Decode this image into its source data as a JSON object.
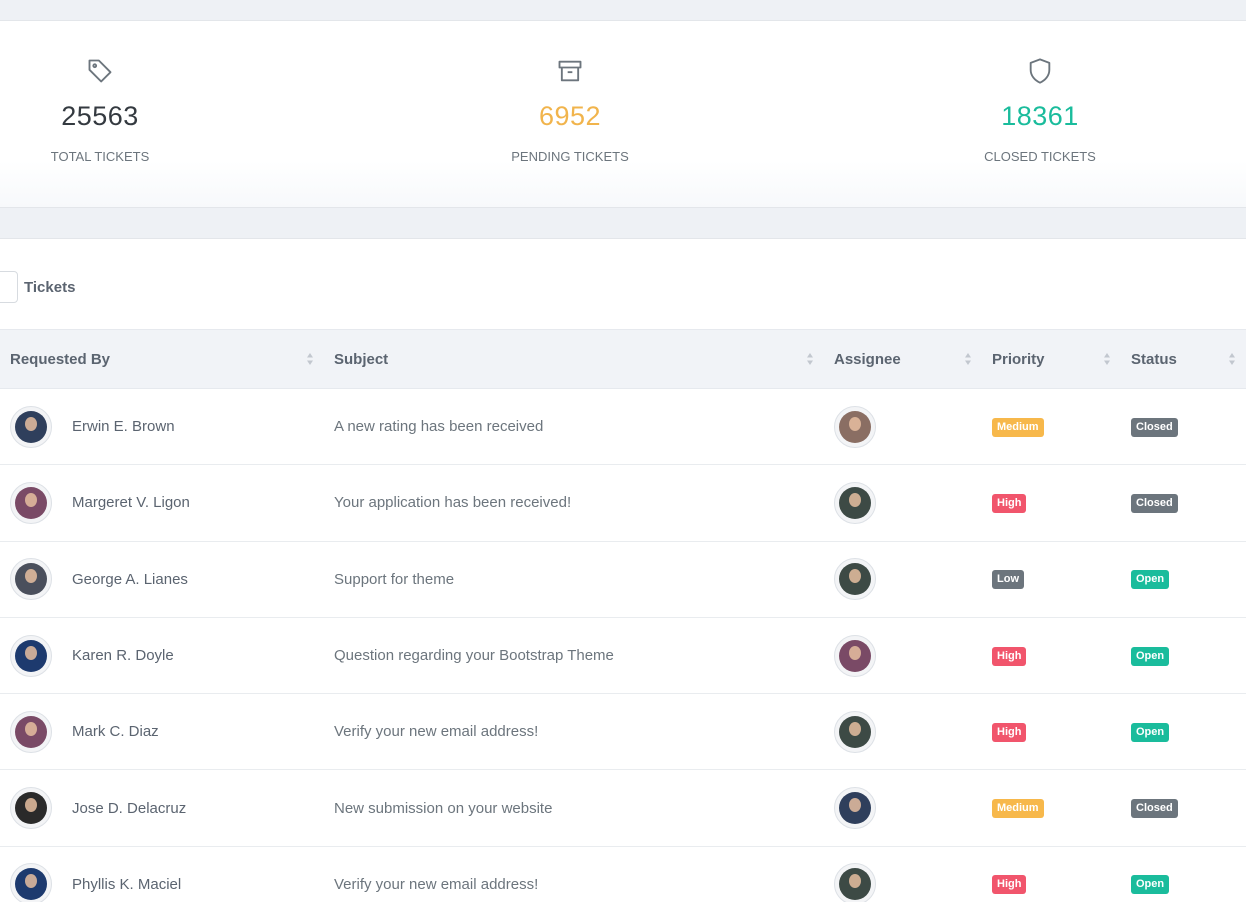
{
  "stats": [
    {
      "id": "total",
      "icon": "tag-icon",
      "value": "25563",
      "label": "Total Tickets",
      "color": "#343a40"
    },
    {
      "id": "pending",
      "icon": "archive-icon",
      "value": "6952",
      "label": "Pending Tickets",
      "color": "#f1b44c"
    },
    {
      "id": "closed",
      "icon": "shield-icon",
      "value": "18361",
      "label": "Closed Tickets",
      "color": "#1abc9c"
    }
  ],
  "tickets_card": {
    "title": "Tickets",
    "columns": [
      "Requested By",
      "Subject",
      "Assignee",
      "Priority",
      "Status"
    ],
    "rows": [
      {
        "requester": "Erwin E. Brown",
        "subject": "A new rating has been received",
        "priority": "Medium",
        "status": "Closed"
      },
      {
        "requester": "Margeret V. Ligon",
        "subject": "Your application has been received!",
        "priority": "High",
        "status": "Closed"
      },
      {
        "requester": "George A. Lianes",
        "subject": "Support for theme",
        "priority": "Low",
        "status": "Open"
      },
      {
        "requester": "Karen R. Doyle",
        "subject": "Question regarding your Bootstrap Theme",
        "priority": "High",
        "status": "Open"
      },
      {
        "requester": "Mark C. Diaz",
        "subject": "Verify your new email address!",
        "priority": "High",
        "status": "Open"
      },
      {
        "requester": "Jose D. Delacruz",
        "subject": "New submission on your website",
        "priority": "Medium",
        "status": "Closed"
      },
      {
        "requester": "Phyllis K. Maciel",
        "subject": "Verify your new email address!",
        "priority": "High",
        "status": "Open"
      }
    ]
  },
  "colors": {
    "medium": "#f7b84b",
    "high": "#f1556c",
    "low": "#6c757d",
    "closed": "#6c757d",
    "open": "#1abc9c"
  }
}
